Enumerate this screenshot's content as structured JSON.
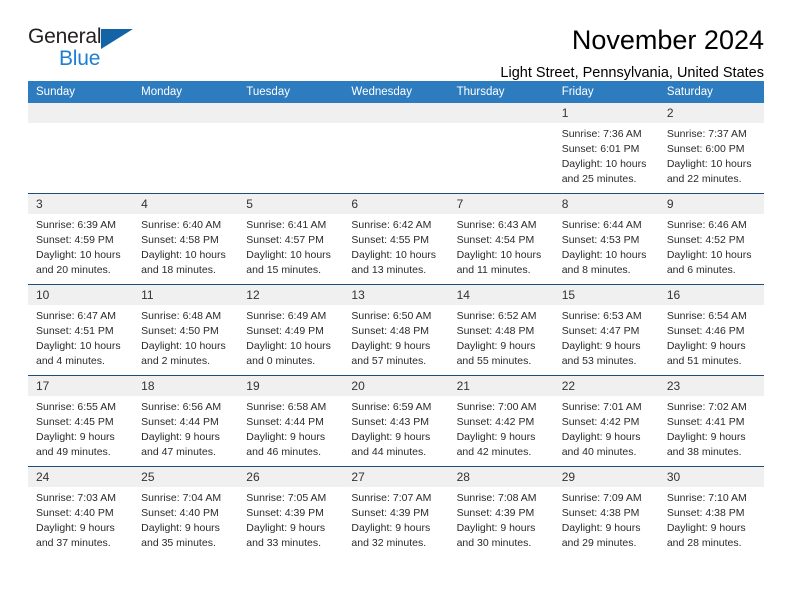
{
  "brand": {
    "name_top": "General",
    "name_bottom": "Blue",
    "triangle_color": "#1464a5",
    "blue_color": "#1c7fd4"
  },
  "header": {
    "month_title": "November 2024",
    "location": "Light Street, Pennsylvania, United States"
  },
  "theme": {
    "header_row_bg": "#2e7cc0",
    "header_row_text": "#ffffff",
    "daynum_bg": "#f0f0f0",
    "row_divider": "#1f4e79"
  },
  "weekday_headers": [
    "Sunday",
    "Monday",
    "Tuesday",
    "Wednesday",
    "Thursday",
    "Friday",
    "Saturday"
  ],
  "labels": {
    "sunrise_prefix": "Sunrise: ",
    "sunset_prefix": "Sunset: ",
    "daylight_prefix": "Daylight: "
  },
  "weeks": [
    [
      {
        "empty": true
      },
      {
        "empty": true
      },
      {
        "empty": true
      },
      {
        "empty": true
      },
      {
        "empty": true
      },
      {
        "day": "1",
        "sunrise": "Sunrise: 7:36 AM",
        "sunset": "Sunset: 6:01 PM",
        "daylight": "Daylight: 10 hours and 25 minutes."
      },
      {
        "day": "2",
        "sunrise": "Sunrise: 7:37 AM",
        "sunset": "Sunset: 6:00 PM",
        "daylight": "Daylight: 10 hours and 22 minutes."
      }
    ],
    [
      {
        "day": "3",
        "sunrise": "Sunrise: 6:39 AM",
        "sunset": "Sunset: 4:59 PM",
        "daylight": "Daylight: 10 hours and 20 minutes."
      },
      {
        "day": "4",
        "sunrise": "Sunrise: 6:40 AM",
        "sunset": "Sunset: 4:58 PM",
        "daylight": "Daylight: 10 hours and 18 minutes."
      },
      {
        "day": "5",
        "sunrise": "Sunrise: 6:41 AM",
        "sunset": "Sunset: 4:57 PM",
        "daylight": "Daylight: 10 hours and 15 minutes."
      },
      {
        "day": "6",
        "sunrise": "Sunrise: 6:42 AM",
        "sunset": "Sunset: 4:55 PM",
        "daylight": "Daylight: 10 hours and 13 minutes."
      },
      {
        "day": "7",
        "sunrise": "Sunrise: 6:43 AM",
        "sunset": "Sunset: 4:54 PM",
        "daylight": "Daylight: 10 hours and 11 minutes."
      },
      {
        "day": "8",
        "sunrise": "Sunrise: 6:44 AM",
        "sunset": "Sunset: 4:53 PM",
        "daylight": "Daylight: 10 hours and 8 minutes."
      },
      {
        "day": "9",
        "sunrise": "Sunrise: 6:46 AM",
        "sunset": "Sunset: 4:52 PM",
        "daylight": "Daylight: 10 hours and 6 minutes."
      }
    ],
    [
      {
        "day": "10",
        "sunrise": "Sunrise: 6:47 AM",
        "sunset": "Sunset: 4:51 PM",
        "daylight": "Daylight: 10 hours and 4 minutes."
      },
      {
        "day": "11",
        "sunrise": "Sunrise: 6:48 AM",
        "sunset": "Sunset: 4:50 PM",
        "daylight": "Daylight: 10 hours and 2 minutes."
      },
      {
        "day": "12",
        "sunrise": "Sunrise: 6:49 AM",
        "sunset": "Sunset: 4:49 PM",
        "daylight": "Daylight: 10 hours and 0 minutes."
      },
      {
        "day": "13",
        "sunrise": "Sunrise: 6:50 AM",
        "sunset": "Sunset: 4:48 PM",
        "daylight": "Daylight: 9 hours and 57 minutes."
      },
      {
        "day": "14",
        "sunrise": "Sunrise: 6:52 AM",
        "sunset": "Sunset: 4:48 PM",
        "daylight": "Daylight: 9 hours and 55 minutes."
      },
      {
        "day": "15",
        "sunrise": "Sunrise: 6:53 AM",
        "sunset": "Sunset: 4:47 PM",
        "daylight": "Daylight: 9 hours and 53 minutes."
      },
      {
        "day": "16",
        "sunrise": "Sunrise: 6:54 AM",
        "sunset": "Sunset: 4:46 PM",
        "daylight": "Daylight: 9 hours and 51 minutes."
      }
    ],
    [
      {
        "day": "17",
        "sunrise": "Sunrise: 6:55 AM",
        "sunset": "Sunset: 4:45 PM",
        "daylight": "Daylight: 9 hours and 49 minutes."
      },
      {
        "day": "18",
        "sunrise": "Sunrise: 6:56 AM",
        "sunset": "Sunset: 4:44 PM",
        "daylight": "Daylight: 9 hours and 47 minutes."
      },
      {
        "day": "19",
        "sunrise": "Sunrise: 6:58 AM",
        "sunset": "Sunset: 4:44 PM",
        "daylight": "Daylight: 9 hours and 46 minutes."
      },
      {
        "day": "20",
        "sunrise": "Sunrise: 6:59 AM",
        "sunset": "Sunset: 4:43 PM",
        "daylight": "Daylight: 9 hours and 44 minutes."
      },
      {
        "day": "21",
        "sunrise": "Sunrise: 7:00 AM",
        "sunset": "Sunset: 4:42 PM",
        "daylight": "Daylight: 9 hours and 42 minutes."
      },
      {
        "day": "22",
        "sunrise": "Sunrise: 7:01 AM",
        "sunset": "Sunset: 4:42 PM",
        "daylight": "Daylight: 9 hours and 40 minutes."
      },
      {
        "day": "23",
        "sunrise": "Sunrise: 7:02 AM",
        "sunset": "Sunset: 4:41 PM",
        "daylight": "Daylight: 9 hours and 38 minutes."
      }
    ],
    [
      {
        "day": "24",
        "sunrise": "Sunrise: 7:03 AM",
        "sunset": "Sunset: 4:40 PM",
        "daylight": "Daylight: 9 hours and 37 minutes."
      },
      {
        "day": "25",
        "sunrise": "Sunrise: 7:04 AM",
        "sunset": "Sunset: 4:40 PM",
        "daylight": "Daylight: 9 hours and 35 minutes."
      },
      {
        "day": "26",
        "sunrise": "Sunrise: 7:05 AM",
        "sunset": "Sunset: 4:39 PM",
        "daylight": "Daylight: 9 hours and 33 minutes."
      },
      {
        "day": "27",
        "sunrise": "Sunrise: 7:07 AM",
        "sunset": "Sunset: 4:39 PM",
        "daylight": "Daylight: 9 hours and 32 minutes."
      },
      {
        "day": "28",
        "sunrise": "Sunrise: 7:08 AM",
        "sunset": "Sunset: 4:39 PM",
        "daylight": "Daylight: 9 hours and 30 minutes."
      },
      {
        "day": "29",
        "sunrise": "Sunrise: 7:09 AM",
        "sunset": "Sunset: 4:38 PM",
        "daylight": "Daylight: 9 hours and 29 minutes."
      },
      {
        "day": "30",
        "sunrise": "Sunrise: 7:10 AM",
        "sunset": "Sunset: 4:38 PM",
        "daylight": "Daylight: 9 hours and 28 minutes."
      }
    ]
  ]
}
